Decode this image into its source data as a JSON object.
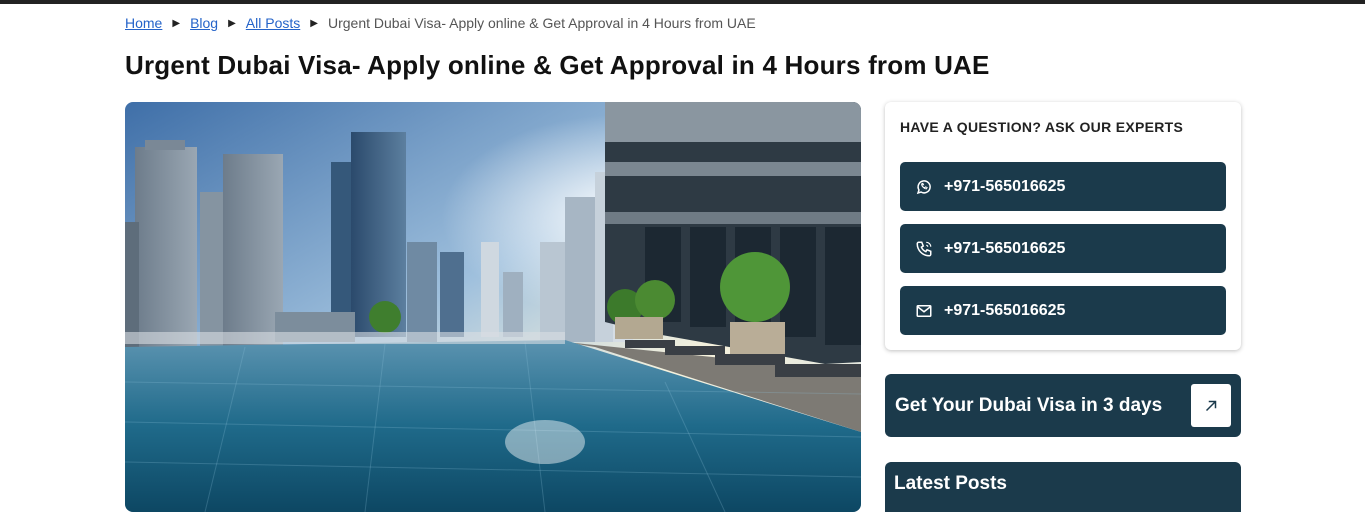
{
  "breadcrumb": {
    "home": "Home",
    "blog": "Blog",
    "all_posts": "All Posts",
    "current": "Urgent Dubai Visa- Apply online & Get Approval in 4 Hours from UAE",
    "separator_icon": "chevron-right-icon"
  },
  "page_title": "Urgent Dubai Visa- Apply online & Get Approval in 4 Hours from UAE",
  "hero": {
    "icon": "rooftop-infinity-pool-skyline-image"
  },
  "sidebar": {
    "ask_title": "HAVE A QUESTION? ASK OUR EXPERTS",
    "contacts": [
      {
        "icon": "whatsapp-icon",
        "label": "+971-565016625"
      },
      {
        "icon": "phone-icon",
        "label": "+971-565016625"
      },
      {
        "icon": "email-icon",
        "label": "+971-565016625"
      }
    ],
    "cta": {
      "label": "Get Your Dubai Visa in 3 days",
      "icon": "arrow-up-right-icon"
    },
    "latest_posts_title": "Latest Posts"
  },
  "colors": {
    "brand_dark": "#1b3a4b",
    "link": "#2463c9",
    "topbar": "#222222"
  }
}
